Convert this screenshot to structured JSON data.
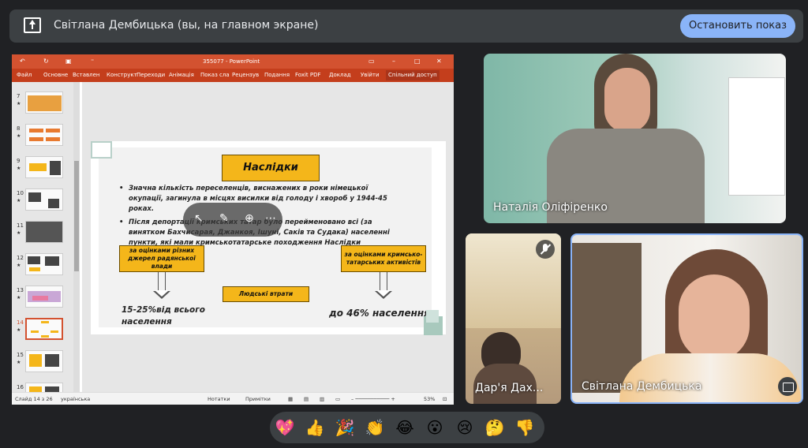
{
  "topbar": {
    "title": "Світлана Дембицька (вы, на главном экране)",
    "stop_button": "Остановить показ"
  },
  "powerpoint": {
    "title": "355077 - PowerPoint",
    "menu": [
      "Файл",
      "Основне",
      "Вставлен",
      "Конструкт",
      "Переходи",
      "Анімація",
      "Показ сла",
      "Рецензув",
      "Подання",
      "Foxit PDF",
      "Доклад",
      "Увійти"
    ],
    "share": "Спільний доступ",
    "thumbnails": [
      {
        "num": "7",
        "active": false
      },
      {
        "num": "8",
        "active": false
      },
      {
        "num": "9",
        "active": false
      },
      {
        "num": "10",
        "active": false
      },
      {
        "num": "11",
        "active": false
      },
      {
        "num": "12",
        "active": false
      },
      {
        "num": "13",
        "active": false
      },
      {
        "num": "14",
        "active": true
      },
      {
        "num": "15",
        "active": false
      },
      {
        "num": "16",
        "active": false
      }
    ],
    "slide": {
      "heading": "Наслідки",
      "bullet1": "Значна кількість переселенців, виснажених в роки німецької окупації, загинула в місцях висилки від голоду і хвороб у 1944-45 роках.",
      "bullet2": "Після депортації кримських татар було перейменовано всі (за винятком Бахчисарая, Джанкоя, Ішуні, Саків та Судака) населенні пункти, які мали кримськотатарське походження Наслідки",
      "box_left": "за оцінками різних джерел радянської влади",
      "box_right": "за оцінками кримсько-татарських активістів",
      "box_center": "Людські втрати",
      "stat_left": "15-25%від всього населення",
      "stat_right": "до 46% населення"
    },
    "status": {
      "slide_info": "Слайд 14 з 26",
      "language": "українська",
      "notes": "Нотатки",
      "comments": "Примітки",
      "zoom": "53%"
    }
  },
  "participants": [
    {
      "name": "Наталія Оліфіренко",
      "muted": false
    },
    {
      "name": "Дар'я Дах...",
      "muted": true
    },
    {
      "name": "Світлана Дембицька",
      "muted": false
    }
  ],
  "reactions": [
    "💖",
    "👍",
    "🎉",
    "👏",
    "😂",
    "😮",
    "😢",
    "🤔",
    "👎"
  ],
  "colors": {
    "accent": "#8ab4f8",
    "ppt": "#c43e1c",
    "slide_box": "#f4b61a"
  }
}
